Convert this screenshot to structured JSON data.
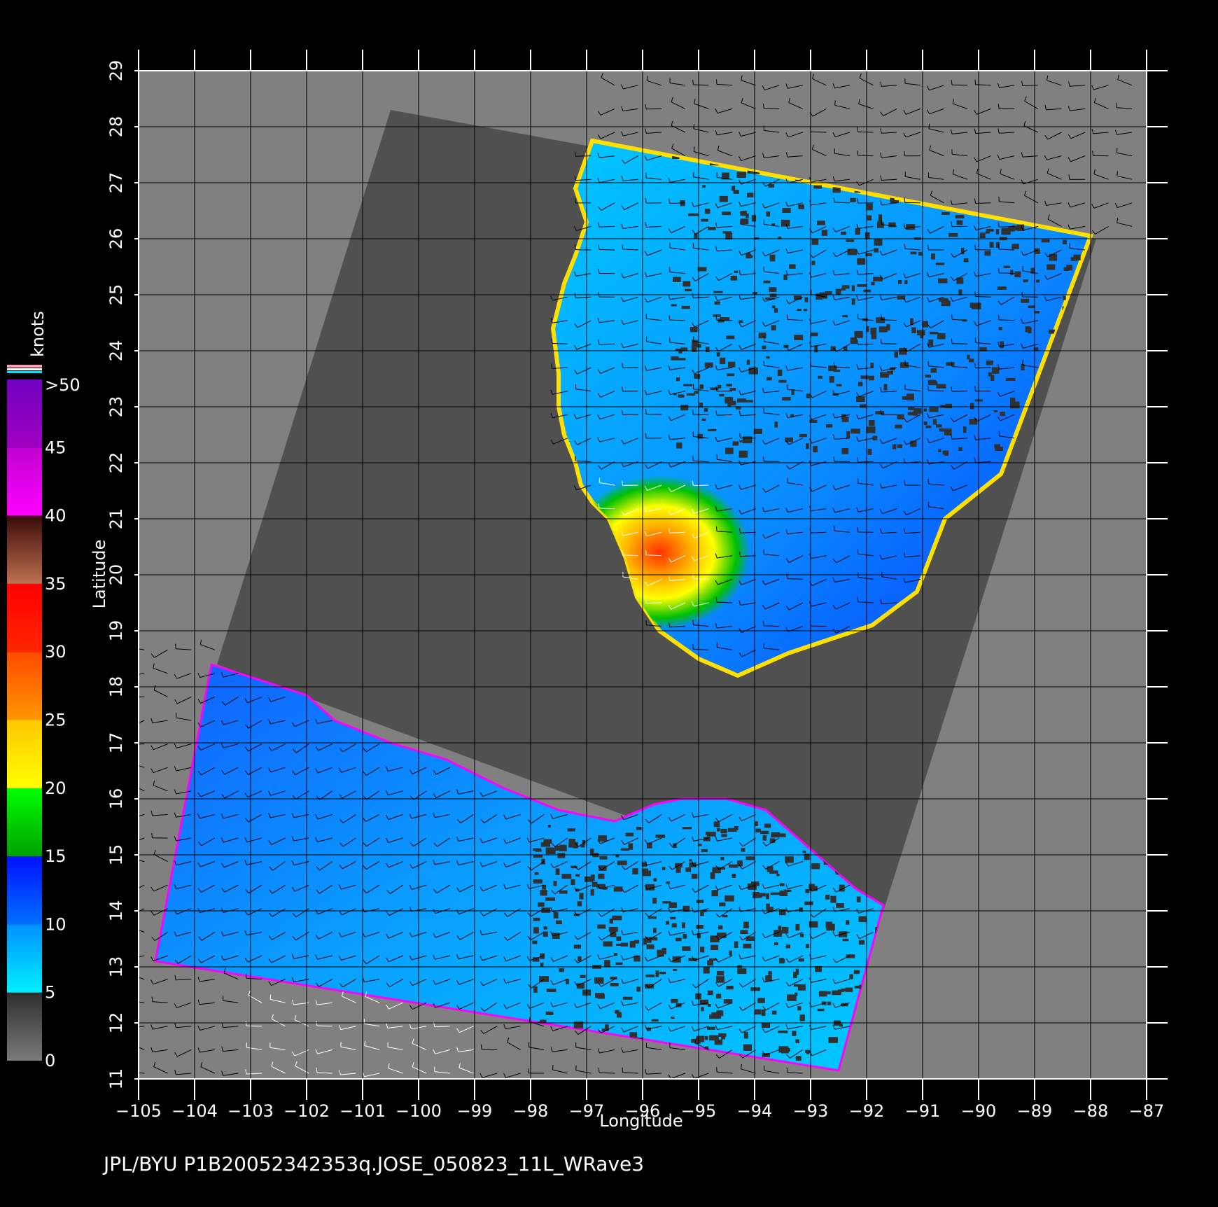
{
  "map": {
    "footer_text": "JPL/BYU  P1B20052342353q.JOSE_050823_11L_WRave3",
    "xlabel": "Longitude",
    "ylabel": "Latitude",
    "x_ticks": [
      "−105",
      "−104",
      "−103",
      "−102",
      "−101",
      "−100",
      "−99",
      "−98",
      "−97",
      "−96",
      "−95",
      "−94",
      "−93",
      "−92",
      "−91",
      "−90",
      "−89",
      "−88",
      "−87"
    ],
    "y_ticks": [
      "11",
      "12",
      "13",
      "14",
      "15",
      "16",
      "17",
      "18",
      "19",
      "20",
      "21",
      "22",
      "23",
      "24",
      "25",
      "26",
      "27",
      "28",
      "29"
    ],
    "lon_range": [
      -105,
      -87
    ],
    "lat_range": [
      11,
      29
    ],
    "colors": {
      "background": "#000000",
      "land": "#808080",
      "no_data": "#505050",
      "grid": "#000000"
    }
  },
  "colorbar": {
    "title": "knots",
    "labels": [
      ">50",
      "45",
      "40",
      "35",
      "30",
      "25",
      "20",
      "15",
      "10",
      "5",
      "0"
    ],
    "bins": [
      {
        "from": 0,
        "to": 5,
        "colors": [
          "#7a7a7a",
          "#2e2e2e"
        ]
      },
      {
        "from": 5,
        "to": 10,
        "colors": [
          "#00f0ff",
          "#0090ff"
        ]
      },
      {
        "from": 10,
        "to": 15,
        "colors": [
          "#0070ff",
          "#0010ff"
        ]
      },
      {
        "from": 15,
        "to": 20,
        "colors": [
          "#00a000",
          "#00ff00"
        ]
      },
      {
        "from": 20,
        "to": 25,
        "colors": [
          "#ffff00",
          "#ffc800"
        ]
      },
      {
        "from": 25,
        "to": 30,
        "colors": [
          "#ff9600",
          "#ff4a00"
        ]
      },
      {
        "from": 30,
        "to": 35,
        "colors": [
          "#ff2600",
          "#ff0000"
        ]
      },
      {
        "from": 35,
        "to": 40,
        "colors": [
          "#c07050",
          "#3a0a0a"
        ]
      },
      {
        "from": 40,
        "to": 45,
        "colors": [
          "#ff00ff",
          "#c000d0"
        ]
      },
      {
        "from": 45,
        "to": 50,
        "colors": [
          "#a000c0",
          "#7000c0"
        ]
      }
    ]
  },
  "swaths": [
    {
      "name": "gulf-of-mexico",
      "outline": [
        [
          -96.9,
          27.75
        ],
        [
          -88.0,
          26.05
        ],
        [
          -89.6,
          21.8
        ],
        [
          -90.6,
          21.0
        ],
        [
          -91.1,
          19.7
        ],
        [
          -91.9,
          19.1
        ],
        [
          -93.4,
          18.6
        ],
        [
          -94.3,
          18.2
        ],
        [
          -95.0,
          18.5
        ],
        [
          -95.7,
          19.0
        ],
        [
          -96.1,
          19.6
        ],
        [
          -96.3,
          20.3
        ],
        [
          -96.6,
          21.0
        ],
        [
          -96.9,
          21.3
        ],
        [
          -97.1,
          21.6
        ],
        [
          -97.2,
          22.0
        ],
        [
          -97.4,
          22.5
        ],
        [
          -97.5,
          23.0
        ],
        [
          -97.5,
          23.6
        ],
        [
          -97.6,
          24.4
        ],
        [
          -97.4,
          25.2
        ],
        [
          -97.2,
          25.7
        ],
        [
          -97.0,
          26.3
        ],
        [
          -97.2,
          26.9
        ],
        [
          -96.9,
          27.75
        ]
      ],
      "hotspot_center": [
        -95.7,
        20.4
      ]
    },
    {
      "name": "pacific",
      "outline": [
        [
          -103.7,
          18.4
        ],
        [
          -102.0,
          17.85
        ],
        [
          -101.5,
          17.4
        ],
        [
          -100.5,
          17.0
        ],
        [
          -99.5,
          16.7
        ],
        [
          -98.5,
          16.2
        ],
        [
          -97.5,
          15.8
        ],
        [
          -96.5,
          15.6
        ],
        [
          -95.8,
          15.9
        ],
        [
          -95.3,
          16.0
        ],
        [
          -94.5,
          16.0
        ],
        [
          -93.8,
          15.8
        ],
        [
          -93.0,
          15.1
        ],
        [
          -92.2,
          14.4
        ],
        [
          -91.7,
          14.1
        ],
        [
          -92.5,
          11.15
        ],
        [
          -104.7,
          13.1
        ]
      ]
    }
  ],
  "no_data_region": [
    [
      -100.5,
      28.3
    ],
    [
      -87.9,
      26.0
    ],
    [
      -91.7,
      14.0
    ],
    [
      -103.6,
      18.4
    ]
  ]
}
